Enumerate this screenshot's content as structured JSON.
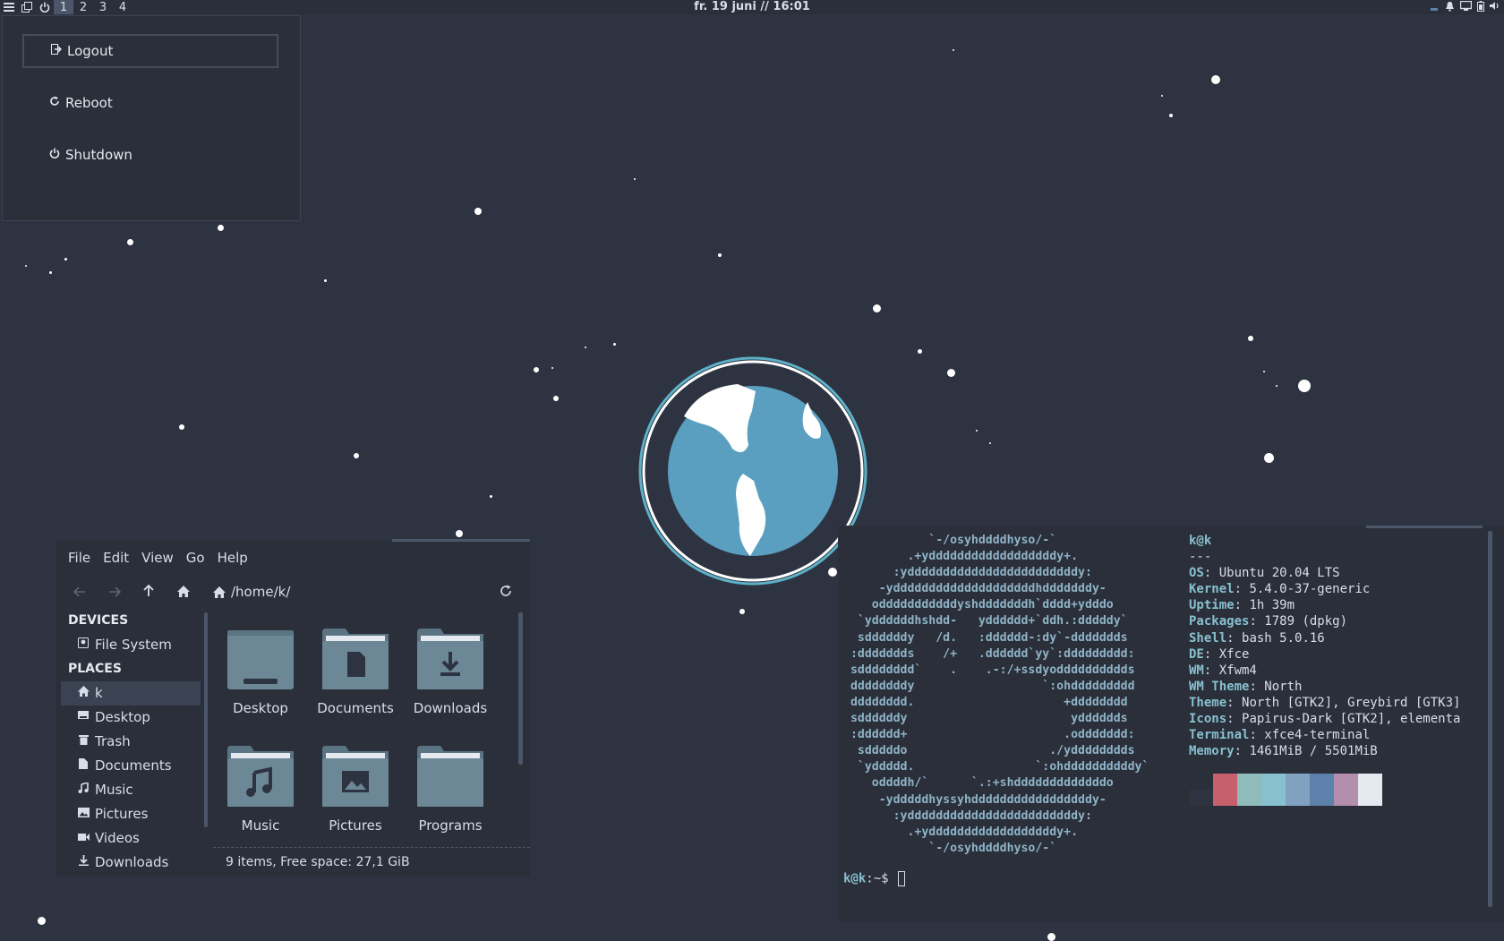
{
  "panel": {
    "workspaces": [
      "1",
      "2",
      "3",
      "4"
    ],
    "clock": "fr. 19 juni // 16:01"
  },
  "session_menu": {
    "logout": "Logout",
    "reboot": "Reboot",
    "shutdown": "Shutdown"
  },
  "file_manager": {
    "menu": [
      "File",
      "Edit",
      "View",
      "Go",
      "Help"
    ],
    "path": "/home/k/",
    "sections": {
      "devices": "DEVICES",
      "places": "PLACES"
    },
    "devices": [
      "File System"
    ],
    "places": [
      "k",
      "Desktop",
      "Trash",
      "Documents",
      "Music",
      "Pictures",
      "Videos",
      "Downloads"
    ],
    "items": [
      "Desktop",
      "Documents",
      "Downloads",
      "Music",
      "Pictures",
      "Programs"
    ],
    "status": "9 items, Free space: 27,1 GiB"
  },
  "terminal": {
    "ascii": [
      "            `-/osyhddddhyso/-`",
      "         .+yddddddddddddddddddy+.",
      "       :yddddddddddddddddddddddddy:",
      "     -yddddddddddddddddddddhdddddddy-",
      "    odddddddddddyshdddddddh`dddd+ydddo",
      "  `yddddddhshdd-   ydddddd+`ddh.:dddddy`",
      "  sddddddy   /d.   :dddddd-:dy`-ddddddds",
      " :ddddddds    /+   .dddddd`yy`:ddddddddd:",
      " sdddddddd`    .    .-:/+ssdyodddddddddds",
      " ddddddddy                  `:ohddddddddd",
      " dddddddd.                     +dddddddd",
      " sddddddy                       ydddddds",
      " :dddddd+                      .oddddddd:",
      "  sdddddo                    ./ydddddddds",
      "  `yddddd.                 `:ohddddddddddy`",
      "    oddddh/`      `.:+shdddddddddddddo",
      "     -ydddddhyssyhdddddddddddddddddy-",
      "       :yddddddddddddddddddddddddy:",
      "         .+yddddddddddddddddddy+.",
      "            `-/osyhddddhyso/-`"
    ],
    "user_host": "k@k",
    "separator": "---",
    "info": [
      {
        "key": "OS",
        "value": "Ubuntu 20.04 LTS"
      },
      {
        "key": "Kernel",
        "value": "5.4.0-37-generic"
      },
      {
        "key": "Uptime",
        "value": "1h 39m"
      },
      {
        "key": "Packages",
        "value": "1789 (dpkg)"
      },
      {
        "key": "Shell",
        "value": "bash 5.0.16"
      },
      {
        "key": "DE",
        "value": "Xfce"
      },
      {
        "key": "WM",
        "value": "Xfwm4"
      },
      {
        "key": "WM Theme",
        "value": "North"
      },
      {
        "key": "Theme",
        "value": "North [GTK2], Greybird [GTK3]"
      },
      {
        "key": "Icons",
        "value": "Papirus-Dark [GTK2], elementa"
      },
      {
        "key": "Terminal",
        "value": "xfce4-terminal"
      },
      {
        "key": "Memory",
        "value": "1461MiB / 5501MiB"
      }
    ],
    "palette": [
      "#2d3340",
      "#c6606d",
      "#8fbcbb",
      "#88c0d0",
      "#81a1c1",
      "#5e81ac",
      "#b48ead",
      "#e5e9f0"
    ],
    "prompt_user": "k@k",
    "prompt_rest": ":~$"
  }
}
